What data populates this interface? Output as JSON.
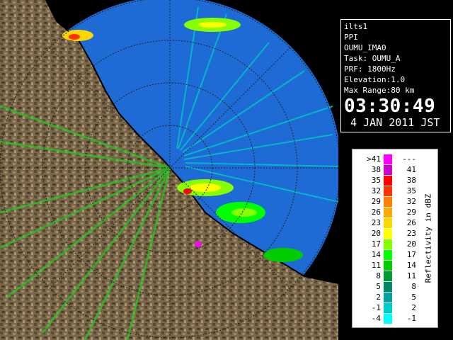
{
  "info_panel": {
    "site": "ilts1",
    "product": "PPI",
    "product_name": "OUMU_IMA0",
    "task": "Task: OUMU_A",
    "prf": "PRF: 1800Hz",
    "elevation": "Elevation:1.0",
    "max_range": "Max Range:80 km",
    "time": "03:30:49",
    "date": " 4 JAN 2011 JST"
  },
  "legend": {
    "title": "Reflectivity in dBZ",
    "rows": [
      {
        "lo": ">41",
        "hi": "---",
        "color": "#ff00ff"
      },
      {
        "lo": "38",
        "hi": "41",
        "color": "#cc00cc"
      },
      {
        "lo": "35",
        "hi": "38",
        "color": "#ff0000"
      },
      {
        "lo": "32",
        "hi": "35",
        "color": "#ff3300"
      },
      {
        "lo": "29",
        "hi": "32",
        "color": "#ff8000"
      },
      {
        "lo": "26",
        "hi": "29",
        "color": "#ffaa00"
      },
      {
        "lo": "23",
        "hi": "26",
        "color": "#ffd700"
      },
      {
        "lo": "20",
        "hi": "23",
        "color": "#ffff00"
      },
      {
        "lo": "17",
        "hi": "20",
        "color": "#88ff00"
      },
      {
        "lo": "14",
        "hi": "17",
        "color": "#00ff00"
      },
      {
        "lo": "11",
        "hi": "14",
        "color": "#00cc00"
      },
      {
        "lo": "8",
        "hi": "11",
        "color": "#009933"
      },
      {
        "lo": "5",
        "hi": "8",
        "color": "#008866"
      },
      {
        "lo": "2",
        "hi": "5",
        "color": "#00a0a0"
      },
      {
        "lo": "-1",
        "hi": "2",
        "color": "#00cccc"
      },
      {
        "lo": "-4",
        "hi": "-1",
        "color": "#00ffff"
      }
    ]
  },
  "map": {
    "sea_color": "#1e6bd6",
    "land_color": "#7a6648",
    "range_ring_color": "#222222",
    "coastline_color": "#000000"
  }
}
